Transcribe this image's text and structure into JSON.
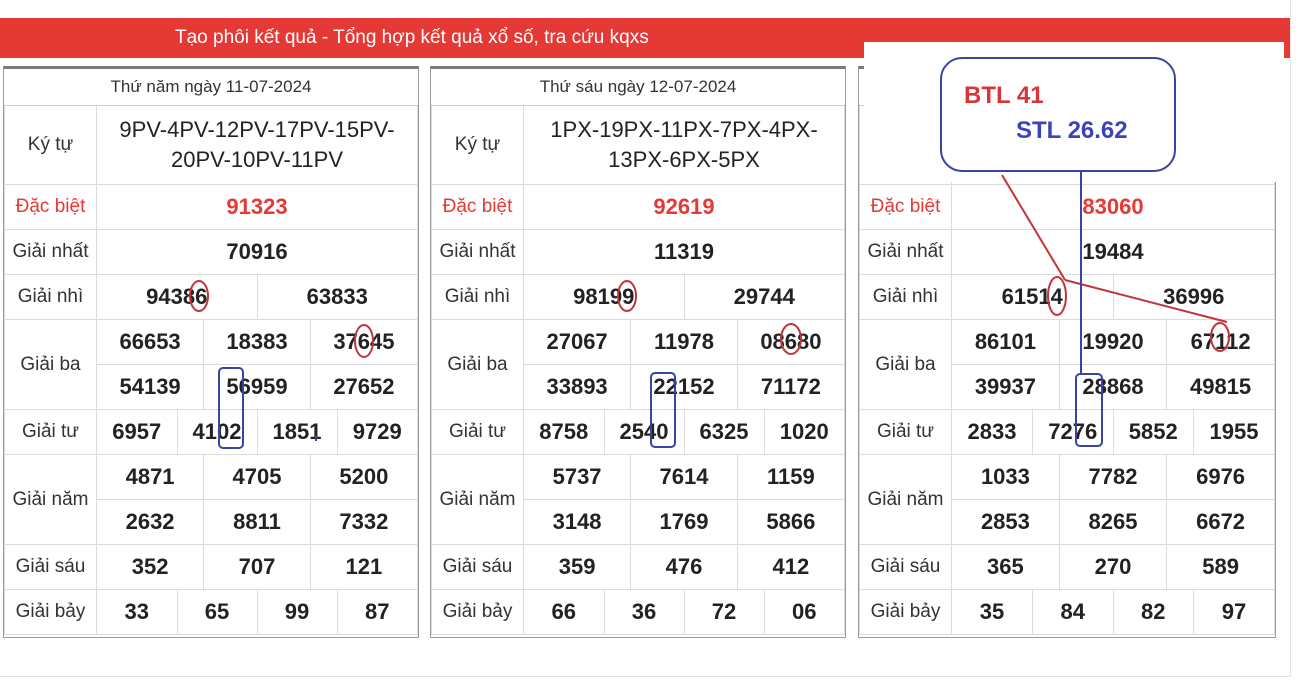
{
  "header": {
    "title": "Tạo phôi kết quả - Tổng hợp kết quả xổ số, tra cứu kqxs"
  },
  "labels": {
    "kytu": "Ký tự",
    "db": "Đặc biệt",
    "g1": "Giải nhất",
    "g2": "Giải nhì",
    "g3": "Giải ba",
    "g4": "Giải tư",
    "g5": "Giải năm",
    "g6": "Giải sáu",
    "g7": "Giải bảy"
  },
  "panels": [
    {
      "date": "Thứ năm ngày 11-07-2024",
      "kytu": "9PV-4PV-12PV-17PV-15PV-20PV-10PV-11PV",
      "db": "91323",
      "g1": "70916",
      "g2": [
        "94386",
        "63833"
      ],
      "g3": [
        "66653",
        "18383",
        "37645",
        "54139",
        "56959",
        "27652"
      ],
      "g4": [
        "6957",
        "4102",
        "1851",
        "9729"
      ],
      "g5": [
        "4871",
        "4705",
        "5200",
        "2632",
        "8811",
        "7332"
      ],
      "g6": [
        "352",
        "707",
        "121"
      ],
      "g7": [
        "33",
        "65",
        "99",
        "87"
      ]
    },
    {
      "date": "Thứ sáu ngày 12-07-2024",
      "kytu": "1PX-19PX-11PX-7PX-4PX-13PX-6PX-5PX",
      "db": "92619",
      "g1": "11319",
      "g2": [
        "98199",
        "29744"
      ],
      "g3": [
        "27067",
        "11978",
        "08680",
        "33893",
        "22152",
        "71172"
      ],
      "g4": [
        "8758",
        "2540",
        "6325",
        "1020"
      ],
      "g5": [
        "5737",
        "7614",
        "1159",
        "3148",
        "1769",
        "5866"
      ],
      "g6": [
        "359",
        "476",
        "412"
      ],
      "g7": [
        "66",
        "36",
        "72",
        "06"
      ]
    },
    {
      "date": "",
      "kytu": "",
      "db": "83060",
      "g1": "19484",
      "g2": [
        "61514",
        "36996"
      ],
      "g3": [
        "86101",
        "19920",
        "67112",
        "39937",
        "28868",
        "49815"
      ],
      "g4": [
        "2833",
        "7276",
        "5852",
        "1955"
      ],
      "g5": [
        "1033",
        "7782",
        "6976",
        "2853",
        "8265",
        "6672"
      ],
      "g6": [
        "365",
        "270",
        "589"
      ],
      "g7": [
        "35",
        "84",
        "82",
        "97"
      ]
    }
  ],
  "annotation": {
    "btl": "BTL 41",
    "stl": "STL 26.62",
    "btl_color": "#d8343a",
    "stl_color": "#3a44b8"
  }
}
